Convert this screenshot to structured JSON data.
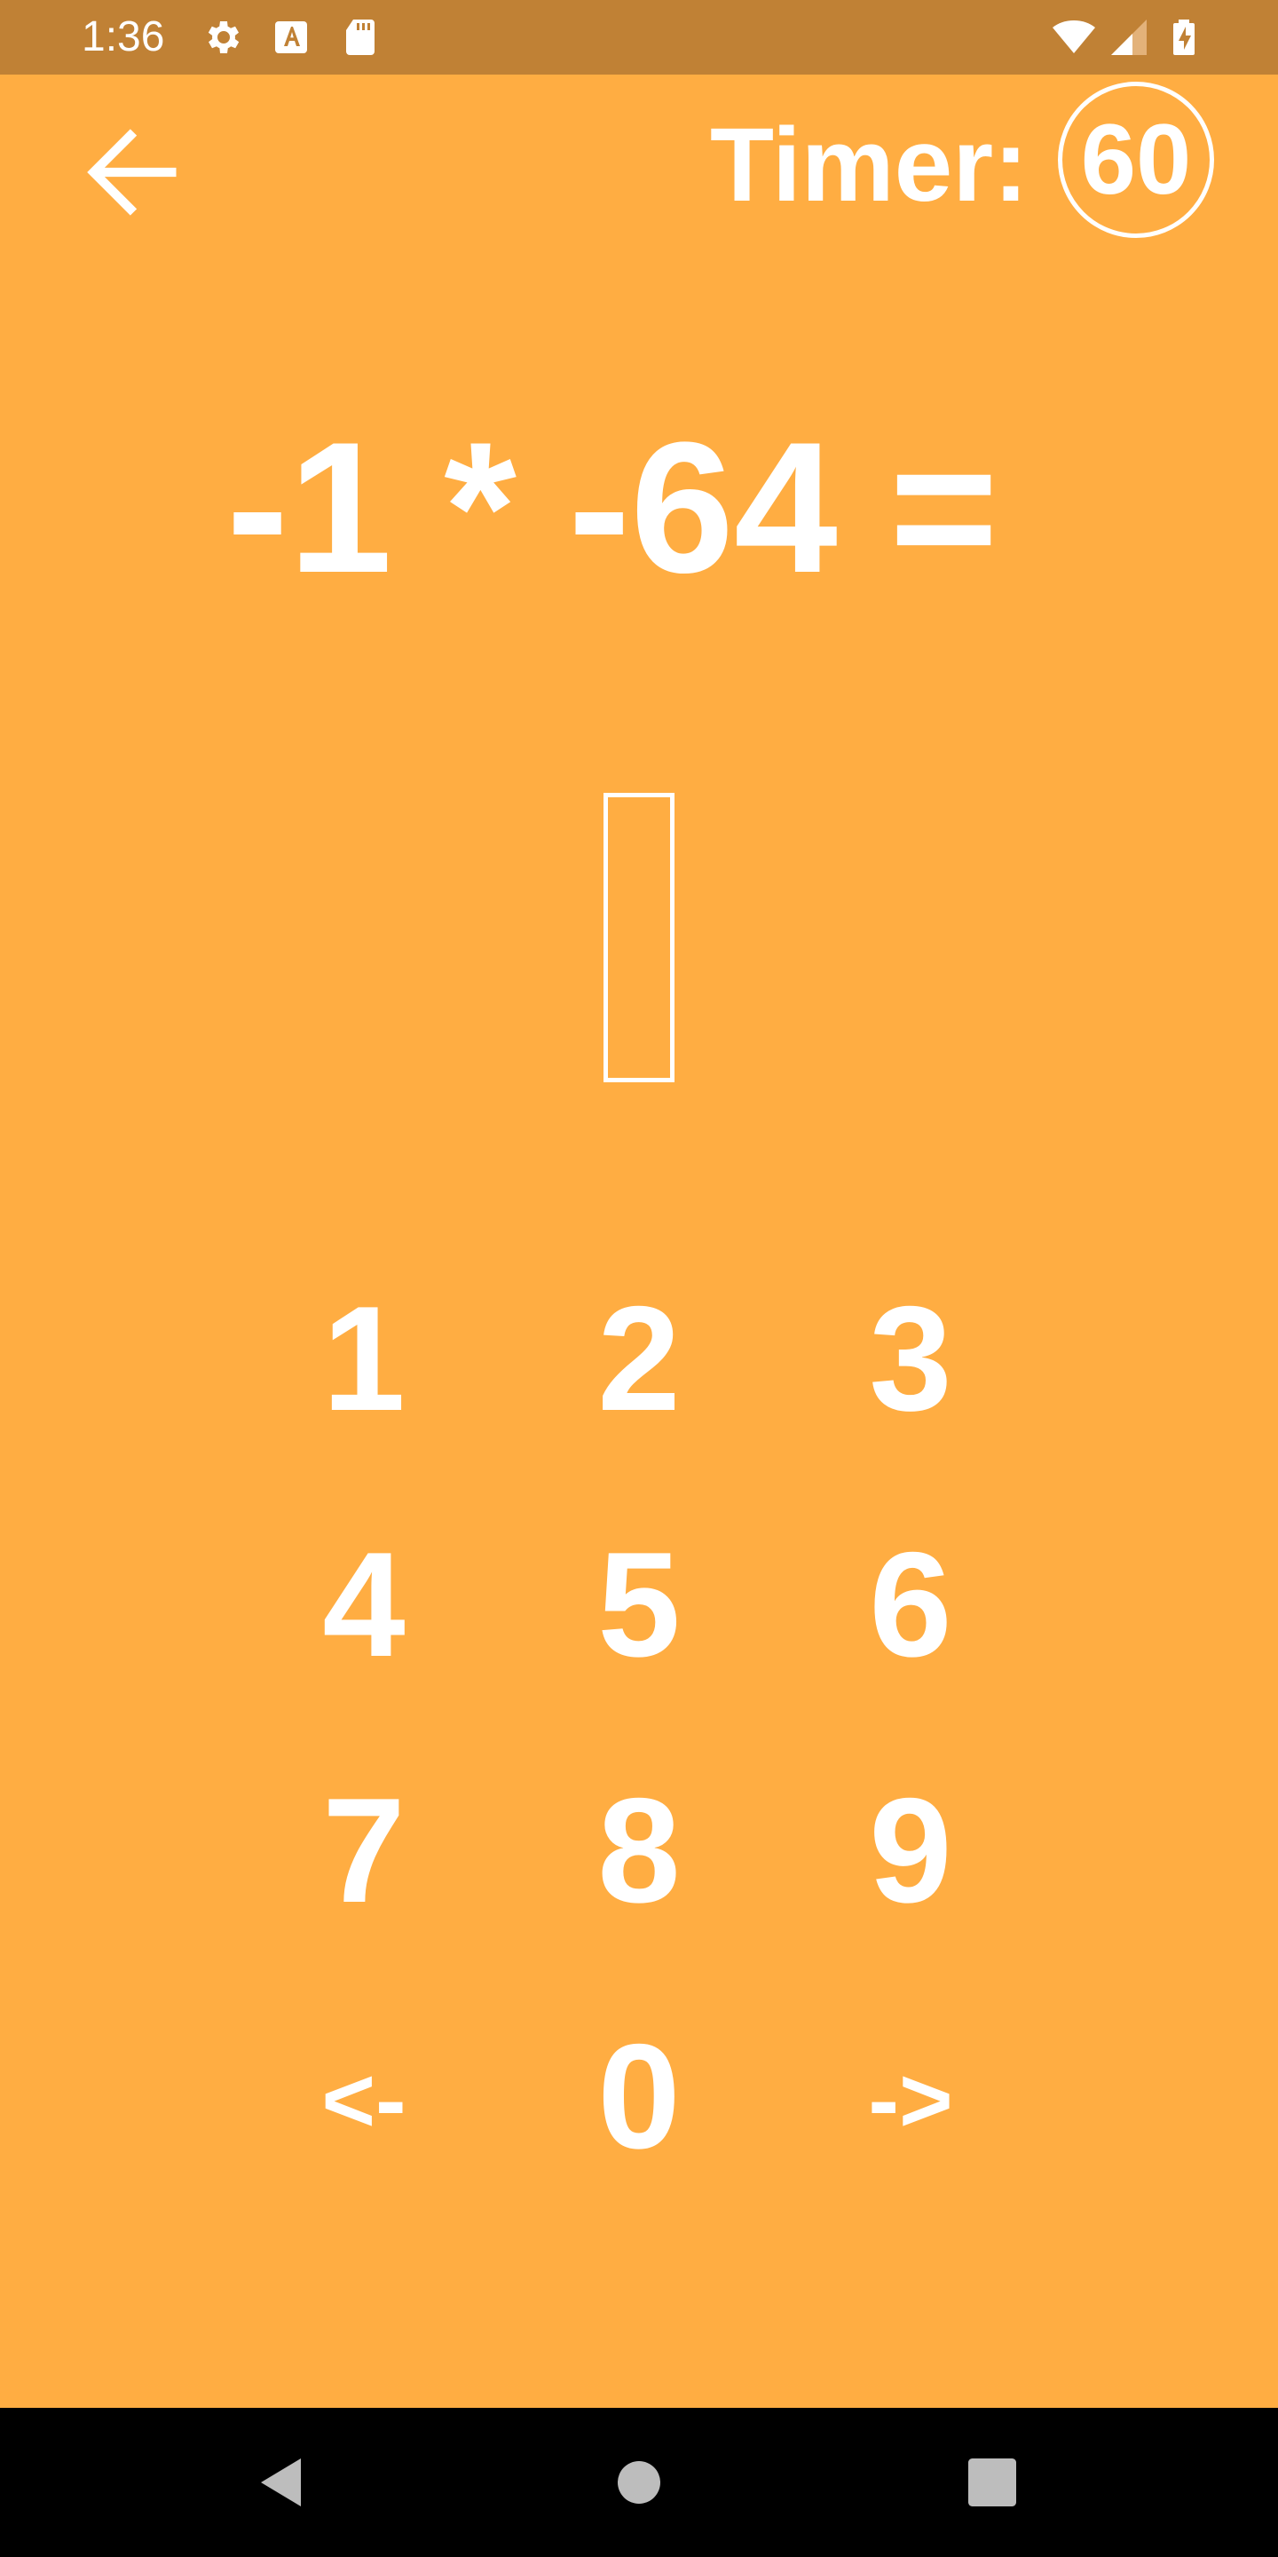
{
  "status_bar": {
    "time": "1:36",
    "icons": [
      "settings-icon",
      "text-a-icon",
      "sd-card-icon",
      "wifi-icon",
      "signal-icon",
      "battery-charging-icon"
    ],
    "background": "#C08135"
  },
  "header": {
    "back_icon": "arrow-left-icon",
    "timer_label": "Timer:",
    "timer_value": "60"
  },
  "quiz": {
    "question": "-1 * -64 =",
    "answer_value": ""
  },
  "keypad": {
    "keys": [
      "1",
      "2",
      "3",
      "4",
      "5",
      "6",
      "7",
      "8",
      "9",
      "<-",
      "0",
      "->"
    ]
  },
  "nav_bar": {
    "icons": [
      "back-triangle-icon",
      "home-circle-icon",
      "recents-square-icon"
    ]
  },
  "colors": {
    "background": "#FFAD42",
    "text": "#FFFFFF"
  }
}
